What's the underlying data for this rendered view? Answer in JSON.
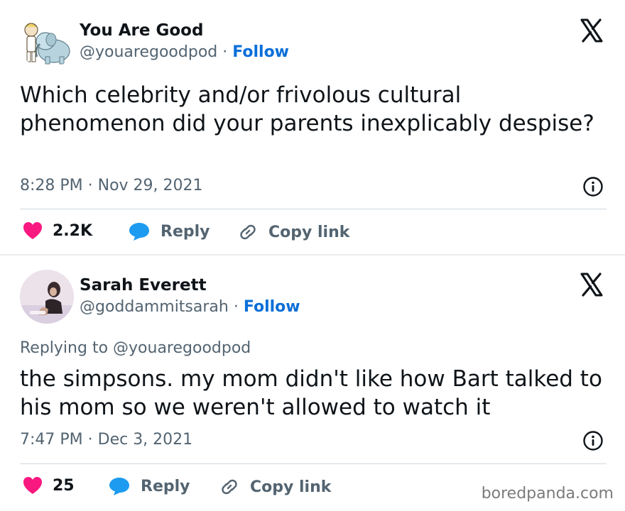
{
  "tweets": [
    {
      "author_name": "You Are Good",
      "handle": "@youaregoodpod",
      "separator": " · ",
      "follow_label": "Follow",
      "text": "Which celebrity and/or frivolous cultural phenomenon did your parents inexplicably despise?",
      "timestamp": "8:28 PM · Nov 29, 2021",
      "likes": "2.2K",
      "reply_label": "Reply",
      "copy_link_label": "Copy link"
    },
    {
      "author_name": "Sarah Everett",
      "handle": "@goddammitsarah",
      "separator": " · ",
      "follow_label": "Follow",
      "replying_to": "Replying to @youaregoodpod",
      "text": "the simpsons. my mom didn't like how Bart talked to his mom so we weren't allowed to watch it",
      "timestamp": "7:47 PM · Dec 3, 2021",
      "likes": "25",
      "reply_label": "Reply",
      "copy_link_label": "Copy link"
    }
  ],
  "watermark": "boredpanda.com",
  "colors": {
    "like": "#f91880",
    "reply": "#1d9bf0",
    "follow": "#0a6fd8",
    "secondary_text": "#536471"
  },
  "icons": [
    "x-logo-icon",
    "info-icon",
    "heart-icon",
    "speech-bubble-icon",
    "link-icon"
  ]
}
